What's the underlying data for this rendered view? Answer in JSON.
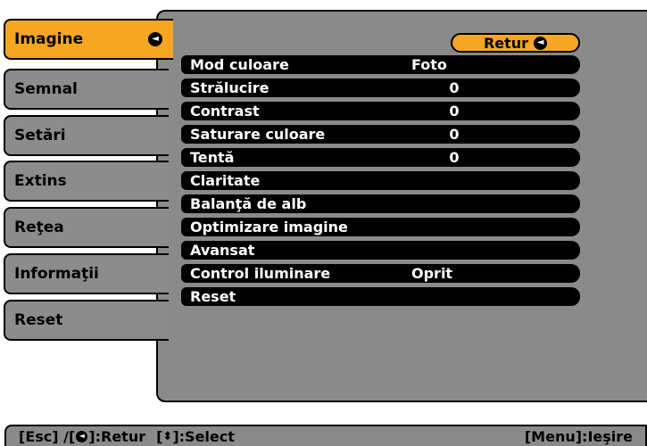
{
  "tabs": [
    {
      "label": "Imagine",
      "active": true
    },
    {
      "label": "Semnal"
    },
    {
      "label": "Setări"
    },
    {
      "label": "Extins"
    },
    {
      "label": "Reţea"
    },
    {
      "label": "Informaţii"
    },
    {
      "label": "Reset"
    }
  ],
  "retur_button": {
    "label": "Retur"
  },
  "menu": [
    {
      "label": "Mod culoare",
      "value": "Foto"
    },
    {
      "label": "Strălucire",
      "value": "0"
    },
    {
      "label": "Contrast",
      "value": "0"
    },
    {
      "label": "Saturare culoare",
      "value": "0"
    },
    {
      "label": "Tentă",
      "value": "0"
    },
    {
      "label": "Claritate",
      "value": ""
    },
    {
      "label": "Balanţă de alb",
      "value": ""
    },
    {
      "label": "Optimizare imagine",
      "value": ""
    },
    {
      "label": "Avansat",
      "value": ""
    },
    {
      "label": "Control iluminare",
      "value": "Oprit"
    },
    {
      "label": "Reset",
      "value": ""
    }
  ],
  "status_bar": {
    "esc": "[Esc] /[",
    "retur": "]:Retur",
    "select_open": "[",
    "select": "]:Select",
    "menu": "[Menu]:Ieşire"
  },
  "colors": {
    "accent": "#f5a623",
    "panel": "#8a8a8a",
    "row": "#000000"
  },
  "icons": {
    "enter": "enter-icon",
    "updown": "up-down-arrow-icon"
  }
}
